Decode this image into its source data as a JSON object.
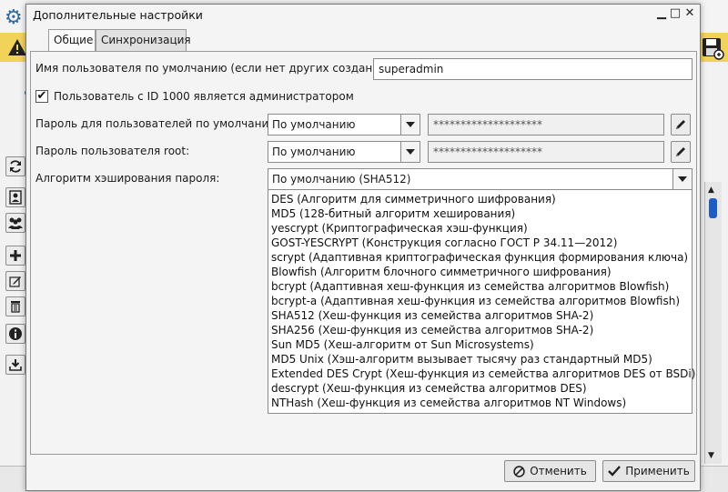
{
  "dialog": {
    "title": "Дополнительные настройки",
    "controls": {
      "minimize": "▁",
      "maximize": "□",
      "close": "✕"
    }
  },
  "tabs": [
    {
      "label": "Общие",
      "active": true
    },
    {
      "label": "Синхронизация",
      "active": false
    }
  ],
  "form": {
    "default_user_label": "Имя пользователя по умолчанию (если нет других созданных):",
    "default_user_value": "superadmin",
    "admin_checkbox_label": "Пользователь с ID 1000 является администратором",
    "admin_checkbox_checked": true,
    "default_password_label": "Пароль для пользователей по умолчанию:",
    "default_password_mode": "По умолчанию",
    "default_password_value": "********************",
    "root_password_label": "Пароль пользователя root:",
    "root_password_mode": "По умолчанию",
    "root_password_value": "********************",
    "hash_label": "Алгоритм хэширования пароля:",
    "hash_selected": "По умолчанию (SHA512)",
    "hash_options": [
      "DES (Алгоритм для симметричного шифрования)",
      "MD5 (128-битный алгоритм хеширования)",
      "yescrypt (Криптографическая хэш-функция)",
      "GOST-YESCRYPT (Конструкция согласно ГОСТ Р 34.11—2012)",
      "scrypt (Адаптивная криптографическая функция формирования ключа)",
      "Blowfish (Алгоритм блочного симметричного шифрования)",
      "bcrypt (Адаптивная хеш-функция из семейства алгоритмов Blowfish)",
      "bcrypt-a (Адаптивная хеш-функция из семейства алгоритмов Blowfish)",
      "SHA512 (Хеш-функция из семейства алгоритмов SHA-2)",
      "SHA256 (Хеш-функция из семейства алгоритмов SHA-2)",
      "Sun MD5 (Хеш-алгоритм от Sun Microsystems)",
      "MD5 Unix (Хэш-алгоритм вызывает тысячу раз стандартный MD5)",
      "Extended DES Crypt (Хеш-функция из семейства алгоритмов DES от BSDi)",
      "descrypt (Хеш-функция из семейства алгоритмов DES)",
      "NTHash (Хеш-функция из семейства алгоритмов NT Windows)"
    ]
  },
  "buttons": {
    "cancel": "Отменить",
    "apply": "Применить"
  },
  "colors": {
    "banner": "#f2d35a",
    "accent": "#2f6aa5",
    "scroll_thumb": "#1e5dc6"
  }
}
